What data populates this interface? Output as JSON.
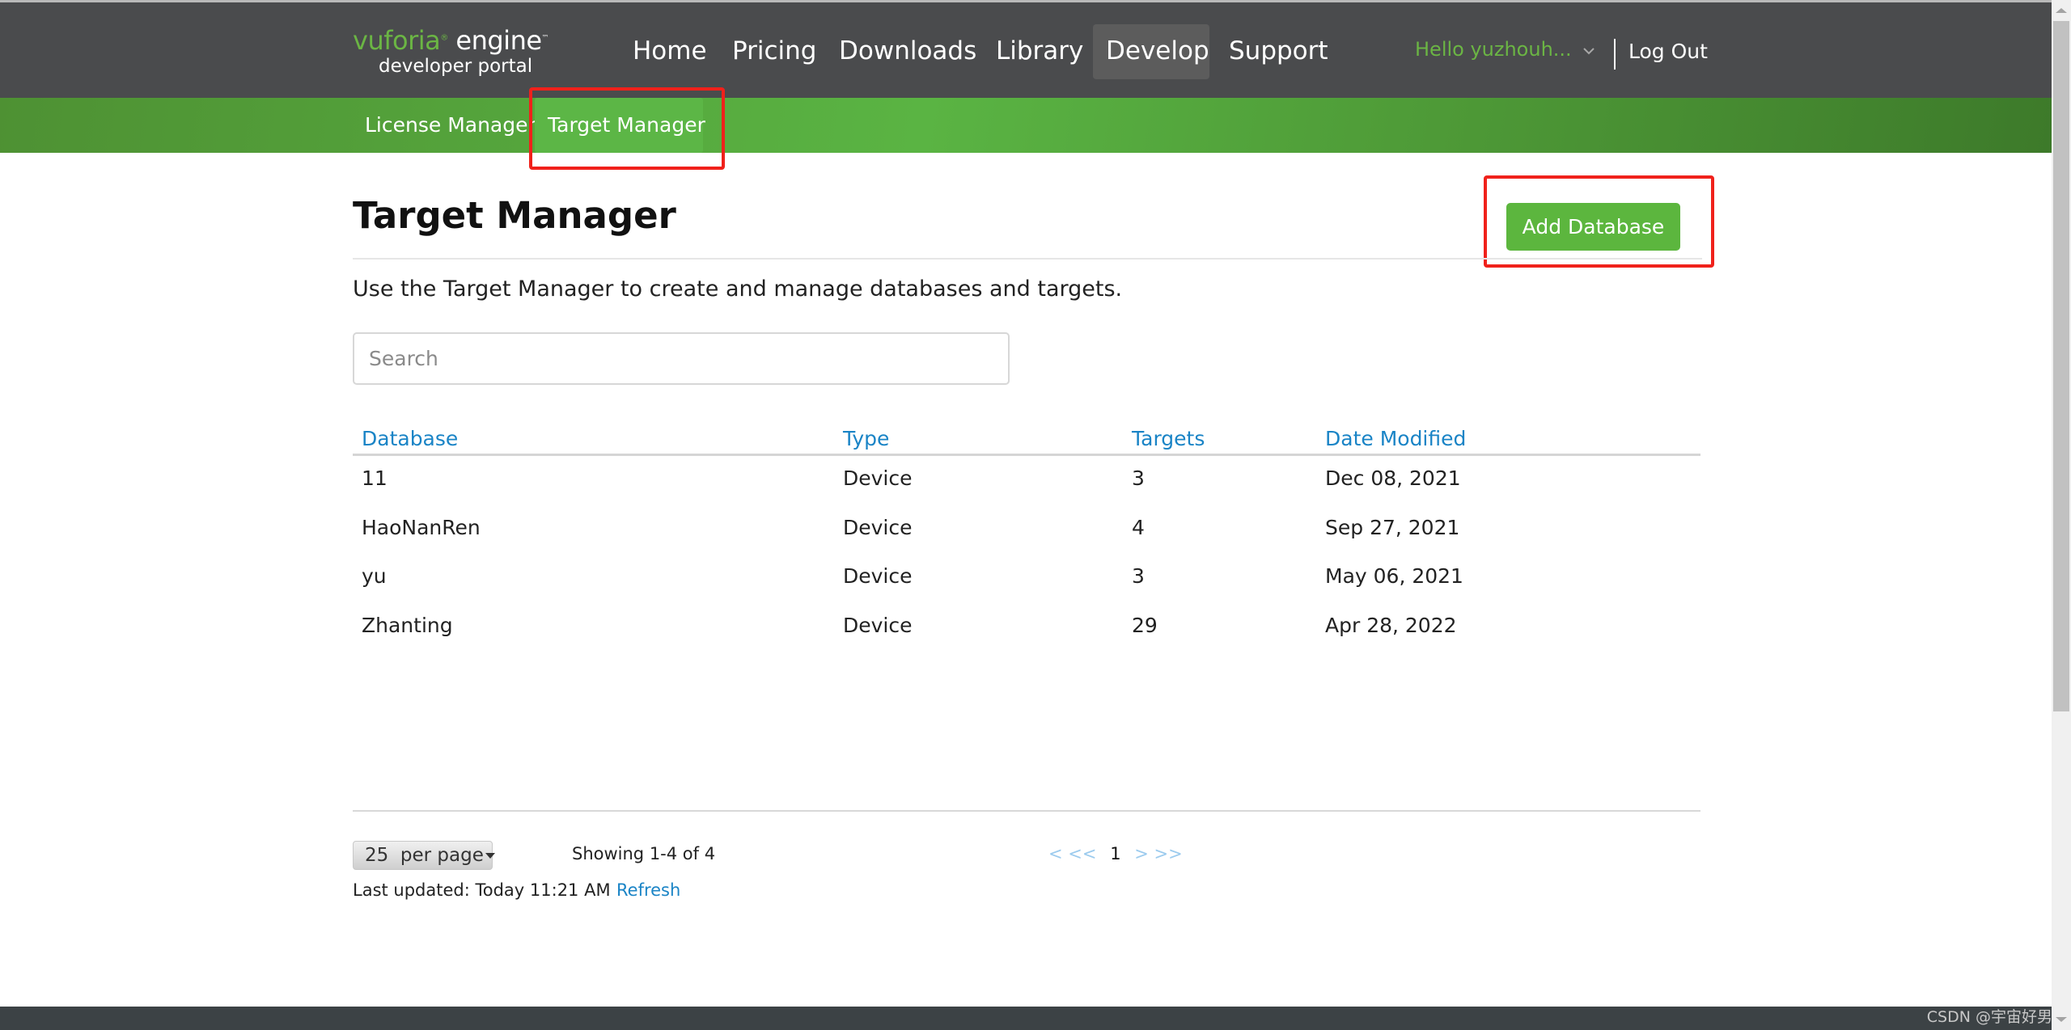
{
  "header": {
    "logo": {
      "brand": "vuforia",
      "registered_mark": "®",
      "product": "engine",
      "trademark": "™",
      "subtitle": "developer portal"
    },
    "nav": [
      {
        "label": "Home",
        "active": false
      },
      {
        "label": "Pricing",
        "active": false
      },
      {
        "label": "Downloads",
        "active": false
      },
      {
        "label": "Library",
        "active": false
      },
      {
        "label": "Develop",
        "active": true
      },
      {
        "label": "Support",
        "active": false
      }
    ],
    "user_greeting": "Hello yuzhouh...",
    "logout_label": "Log Out"
  },
  "subnav": {
    "items": [
      {
        "label": "License Manager",
        "active": false
      },
      {
        "label": "Target Manager",
        "active": true
      }
    ]
  },
  "main": {
    "title": "Target Manager",
    "add_button_label": "Add Database",
    "description": "Use the Target Manager to create and manage databases and targets.",
    "search": {
      "value": "",
      "placeholder": "Search"
    },
    "table": {
      "columns": [
        "Database",
        "Type",
        "Targets",
        "Date Modified"
      ],
      "rows": [
        {
          "database": "11",
          "type": "Device",
          "targets": "3",
          "date_modified": "Dec 08, 2021"
        },
        {
          "database": "HaoNanRen",
          "type": "Device",
          "targets": "4",
          "date_modified": "Sep 27, 2021"
        },
        {
          "database": "yu",
          "type": "Device",
          "targets": "3",
          "date_modified": "May 06, 2021"
        },
        {
          "database": "Zhanting",
          "type": "Device",
          "targets": "29",
          "date_modified": "Apr 28, 2022"
        }
      ]
    },
    "pagination": {
      "per_page_value": "25",
      "per_page_suffix": "per page",
      "showing": "Showing 1-4 of 4",
      "first": "<",
      "prev": "<<",
      "current_page": "1",
      "next": ">",
      "last": ">>"
    },
    "last_updated": "Last updated: Today 11:21 AM",
    "refresh_label": "Refresh"
  },
  "colors": {
    "header_bg": "#4a4b4d",
    "brand_green": "#6bb544",
    "button_green": "#5cb63e",
    "link_blue": "#1a84c6",
    "annotation_red": "#f0211b"
  },
  "watermark": "CSDN @宇宙好男人"
}
